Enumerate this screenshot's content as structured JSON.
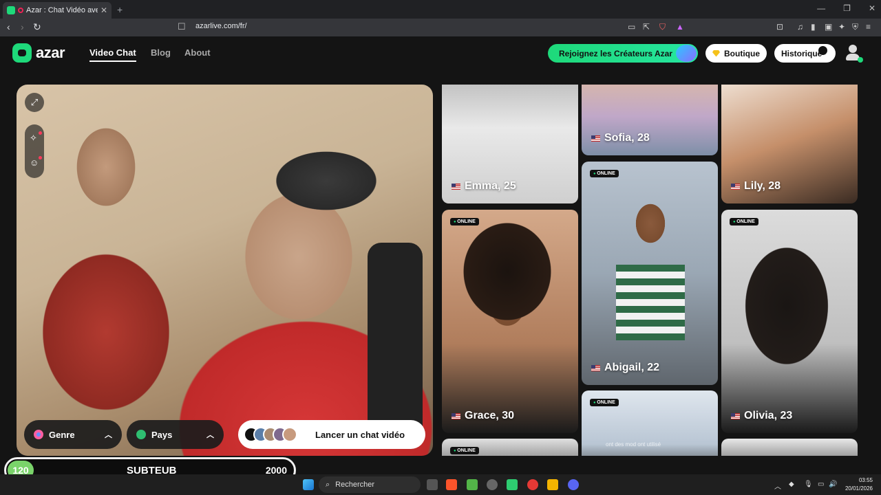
{
  "browser": {
    "tab_title": "Azar : Chat Vidéo avec de no",
    "url": "azarlive.com/fr/"
  },
  "header": {
    "logo_text": "azar",
    "nav": [
      "Video Chat",
      "Blog",
      "About"
    ],
    "creators_label": "Rejoignez les Créateurs Azar",
    "shop_label": "Boutique",
    "history_label": "Historique"
  },
  "video": {
    "gender_label": "Genre",
    "country_label": "Pays",
    "launch_label": "Lancer un chat vidéo"
  },
  "cards": [
    {
      "name": "Emma, 25",
      "online": ""
    },
    {
      "name": "Sofia, 28",
      "online": ""
    },
    {
      "name": "Lily, 28",
      "online": ""
    },
    {
      "name": "Grace, 30",
      "online": "ONLINE"
    },
    {
      "name": "Abigail, 22",
      "online": "ONLINE"
    },
    {
      "name": "Olivia, 23",
      "online": "ONLINE"
    },
    {
      "name": "",
      "online": "ONLINE"
    },
    {
      "name": "",
      "online": "ONLINE"
    },
    {
      "name": "",
      "online": ""
    }
  ],
  "caption": "ont des mod           ont utilisé",
  "sub_bar": {
    "count": "120",
    "label": "SUBTEUB",
    "goal": "2000"
  },
  "taskbar": {
    "search_placeholder": "Rechercher",
    "time": "03:55",
    "date": "20/01/2026"
  },
  "colors": {
    "accent": "#1ed97a",
    "background": "#141414"
  }
}
